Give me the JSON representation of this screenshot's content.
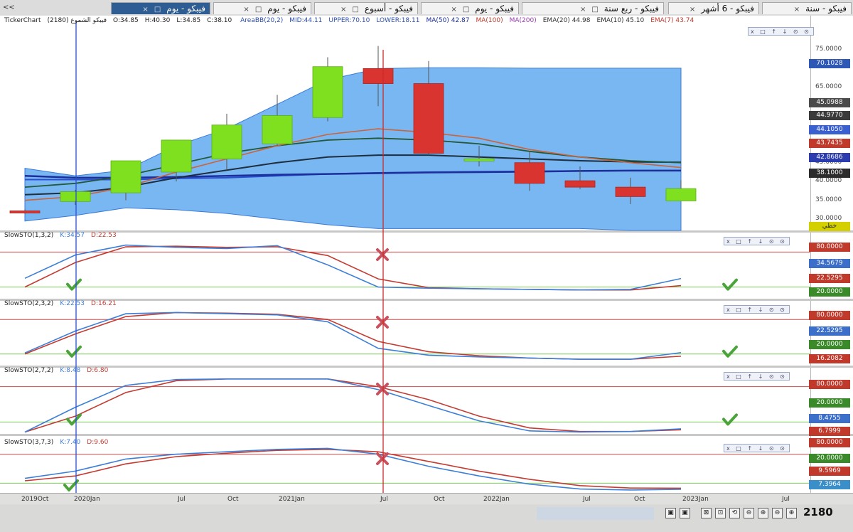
{
  "tabs": [
    {
      "label": "فيبكو - سنة",
      "active": false
    },
    {
      "label": "فيبكو - 6 أشهر",
      "active": false
    },
    {
      "label": "فيبكو - ربع سنة",
      "active": false
    },
    {
      "label": "فيبكو - يوم",
      "active": false
    },
    {
      "label": "فيبكو - أسبوع",
      "active": false
    },
    {
      "label": "فيبكو - يوم",
      "active": false
    },
    {
      "label": "فيبكو - يوم",
      "active": true
    }
  ],
  "tab_close_glyph": "×",
  "tab_max_glyph": "□",
  "collapse_glyph": "<<",
  "main": {
    "title_parts": [
      "TickerChart",
      "(2180) فيبكو الشموع",
      "O:34.85",
      "H:40.30",
      "L:34.85",
      "C:38.10"
    ],
    "indicators": [
      {
        "text": "AreaBB(20,2)",
        "color": "#2a4fb0"
      },
      {
        "text": "MID:44.11",
        "color": "#2a4fb0"
      },
      {
        "text": "UPPER:70.10",
        "color": "#2a4fb0"
      },
      {
        "text": "LOWER:18.11",
        "color": "#2a4fb0"
      },
      {
        "text": "MA(50) 42.87",
        "color": "#1a2f9a"
      },
      {
        "text": "MA(100)",
        "color": "#c0392b"
      },
      {
        "text": "MA(200)",
        "color": "#9b3bb5"
      },
      {
        "text": "EMA(20) 44.98",
        "color": "#333333"
      },
      {
        "text": "EMA(10) 45.10",
        "color": "#333333"
      },
      {
        "text": "EMA(7) 43.74",
        "color": "#c0392b"
      }
    ],
    "ticks": [
      "75.0000",
      "65.0000",
      "45.0000",
      "40.0000",
      "35.0000",
      "30.0000"
    ],
    "badges": [
      {
        "text": "70.1028",
        "color": "#2d58b6"
      },
      {
        "text": "45.0988",
        "color": "#4a4a4a"
      },
      {
        "text": "44.9770",
        "color": "#3a3a3a"
      },
      {
        "text": "44.1050",
        "color": "#3a5fcf"
      },
      {
        "text": "43.7435",
        "color": "#c0392b"
      },
      {
        "text": "42.8686",
        "color": "#2a3cae"
      },
      {
        "text": "38.1000",
        "color": "#2b2b2b"
      }
    ],
    "scale_type": "خطي",
    "scale_type_color": "#d4d000"
  },
  "stochastics": [
    {
      "name": "SlowSTO(1,3,2)",
      "k": "K:34.57",
      "d": "D:22.53",
      "badges": [
        {
          "text": "80.0000",
          "color": "#c0392b"
        },
        {
          "text": "34.5679",
          "color": "#3b6fc9"
        },
        {
          "text": "22.5295",
          "color": "#c0392b"
        },
        {
          "text": "20.0000",
          "color": "#3a8a2a"
        }
      ]
    },
    {
      "name": "SlowSTO(2,3,2)",
      "k": "K:22.53",
      "d": "D:16.21",
      "badges": [
        {
          "text": "80.0000",
          "color": "#c0392b"
        },
        {
          "text": "22.5295",
          "color": "#3b6fc9"
        },
        {
          "text": "20.0000",
          "color": "#3a8a2a"
        },
        {
          "text": "16.2082",
          "color": "#c0392b"
        }
      ]
    },
    {
      "name": "SlowSTO(2,7,2)",
      "k": "K:8.48",
      "d": "D:6.80",
      "badges": [
        {
          "text": "80.0000",
          "color": "#c0392b"
        },
        {
          "text": "20.0000",
          "color": "#3a8a2a"
        },
        {
          "text": "8.4755",
          "color": "#3b6fc9"
        },
        {
          "text": "6.7999",
          "color": "#c0392b"
        }
      ]
    },
    {
      "name": "SlowSTO(3,7,3)",
      "k": "K:7.40",
      "d": "D:9.60",
      "badges": [
        {
          "text": "80.0000",
          "color": "#c0392b"
        },
        {
          "text": "20.0000",
          "color": "#3a8a2a"
        },
        {
          "text": "9.5969",
          "color": "#c0392b"
        },
        {
          "text": "7.3964",
          "color": "#3b8fc9"
        }
      ]
    }
  ],
  "time_axis": [
    "2019Oct",
    "2020Jan",
    "Jul",
    "Oct",
    "2021Jan",
    "Jul",
    "Oct",
    "2022Jan",
    "Jul",
    "Oct",
    "2023Jan",
    "Jul"
  ],
  "panel_controls": "x □ ↑ ↓ ⊙ ⊙",
  "status": {
    "zoom_value": "2180",
    "buttons": [
      "▣",
      "▣",
      "⊠",
      "⊡",
      "⟲",
      "⊖",
      "⊕",
      "⊖",
      "⊕",
      "→",
      "⇤"
    ]
  },
  "colors": {
    "bull": "#7fe020",
    "bear": "#d9342f",
    "band_fill": "#62aaf0",
    "k_line": "#3d7fd8",
    "d_line": "#c43b32",
    "overbought_line": "#d04848",
    "oversold_line": "#7ccb5a",
    "cursor_line": "#cc2b2b",
    "left_cursor": "#2a4fd0",
    "check": "#4aa43a",
    "cross": "#c9515d"
  },
  "chart_data": [
    {
      "type": "candlestick",
      "title": "(2180) فيبكو الشموع",
      "ylim": [
        27,
        78
      ],
      "x_count": 14,
      "x": [
        "2019Q4",
        "2020Q1",
        "2020Q2",
        "2020Q3",
        "2020Q4",
        "2021Q1",
        "2021Q2",
        "2021Q3",
        "2021Q4",
        "2022Q1",
        "2022Q2",
        "2022Q3",
        "2022Q4",
        "2023Q1"
      ],
      "open": [
        32.2,
        34.7,
        37.0,
        42.5,
        46.0,
        50.0,
        57.0,
        70.0,
        66.0,
        45.5,
        45.0,
        40.2,
        38.5,
        34.85
      ],
      "high": [
        32.6,
        37.8,
        45.0,
        51.0,
        58.0,
        63.0,
        73.0,
        76.0,
        72.0,
        49.5,
        48.0,
        44.0,
        41.0,
        40.3
      ],
      "low": [
        31.4,
        33.8,
        35.0,
        40.0,
        43.0,
        49.5,
        56.0,
        60.0,
        47.0,
        44.0,
        37.5,
        38.0,
        34.0,
        34.85
      ],
      "close": [
        31.8,
        37.3,
        45.5,
        51.0,
        55.0,
        57.5,
        70.5,
        66.0,
        47.5,
        46.0,
        39.5,
        38.5,
        36.0,
        38.1
      ],
      "band_upper": [
        43.5,
        41.5,
        43.0,
        49.5,
        54.0,
        60.5,
        67.0,
        70.0,
        70.2,
        70.2,
        70.1,
        70.1,
        70.1,
        70.1
      ],
      "band_lower": [
        29.5,
        31.0,
        33.0,
        32.5,
        31.5,
        30.0,
        28.5,
        27.5,
        27.5,
        27.5,
        27.5,
        27.5,
        27.0,
        27.0
      ],
      "ema7": [
        35.0,
        36.0,
        38.5,
        42.5,
        46.0,
        49.5,
        52.5,
        54.0,
        53.0,
        51.5,
        48.5,
        46.5,
        45.0,
        43.7
      ],
      "ema20": [
        38.5,
        39.5,
        41.5,
        44.5,
        47.5,
        49.5,
        51.0,
        51.5,
        51.0,
        50.0,
        48.0,
        46.5,
        45.5,
        45.0
      ],
      "ema10": [
        36.5,
        37.0,
        38.5,
        41.0,
        43.0,
        45.0,
        46.5,
        47.0,
        47.0,
        46.5,
        46.0,
        45.5,
        45.2,
        45.1
      ],
      "ma50": [
        41.5,
        41.0,
        41.0,
        41.2,
        41.5,
        41.8,
        42.0,
        42.2,
        42.4,
        42.5,
        42.6,
        42.8,
        42.9,
        42.9
      ],
      "ma100": [
        40.5,
        40.5,
        40.5,
        40.8,
        41.0,
        41.5,
        42.0,
        42.3,
        42.5,
        42.6,
        42.7,
        42.8,
        42.9,
        42.9
      ]
    },
    {
      "type": "line",
      "title": "SlowSTO(1,3,2)",
      "ylim": [
        0,
        100
      ],
      "x_count": 14,
      "series": [
        {
          "name": "K",
          "values": [
            35,
            75,
            92,
            88,
            86,
            91,
            58,
            20,
            18,
            17,
            16,
            15,
            16,
            34.57
          ]
        },
        {
          "name": "D",
          "values": [
            20,
            62,
            89,
            90,
            88,
            89,
            74,
            34,
            19,
            17,
            16,
            15,
            15,
            22.53
          ]
        }
      ],
      "levels": [
        80,
        20
      ]
    },
    {
      "type": "line",
      "title": "SlowSTO(2,3,2)",
      "ylim": [
        0,
        100
      ],
      "x_count": 14,
      "series": [
        {
          "name": "K",
          "values": [
            22,
            60,
            90,
            92,
            90,
            88,
            76,
            30,
            18,
            15,
            13,
            11,
            11,
            22.53
          ]
        },
        {
          "name": "D",
          "values": [
            20,
            55,
            85,
            92,
            91,
            89,
            80,
            42,
            24,
            17,
            13,
            11,
            11,
            16.21
          ]
        }
      ],
      "levels": [
        80,
        20
      ]
    },
    {
      "type": "line",
      "title": "SlowSTO(2,7,2)",
      "ylim": [
        0,
        100
      ],
      "x_count": 14,
      "series": [
        {
          "name": "K",
          "values": [
            3,
            45,
            82,
            92,
            93,
            93,
            93,
            75,
            48,
            22,
            5,
            3,
            4,
            8.48
          ]
        },
        {
          "name": "D",
          "values": [
            3,
            30,
            70,
            90,
            93,
            93,
            93,
            80,
            58,
            30,
            10,
            4,
            4,
            6.8
          ]
        }
      ],
      "levels": [
        80,
        20
      ]
    },
    {
      "type": "line",
      "title": "SlowSTO(3,7,3)",
      "ylim": [
        0,
        100
      ],
      "x_count": 14,
      "series": [
        {
          "name": "K",
          "values": [
            30,
            45,
            70,
            80,
            85,
            90,
            92,
            80,
            55,
            35,
            18,
            8,
            6,
            7.4
          ]
        },
        {
          "name": "D",
          "values": [
            25,
            35,
            60,
            75,
            82,
            88,
            90,
            85,
            65,
            45,
            28,
            15,
            10,
            9.6
          ]
        }
      ],
      "levels": [
        80,
        20
      ]
    }
  ]
}
